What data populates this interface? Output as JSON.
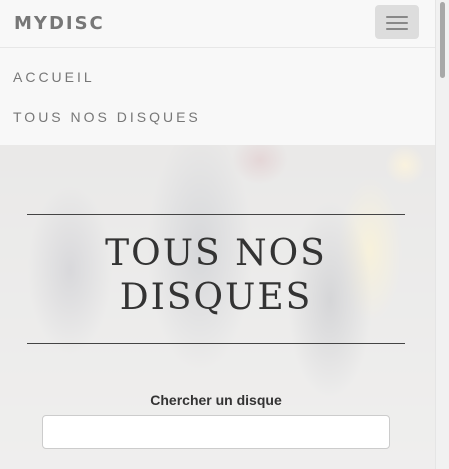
{
  "navbar": {
    "brand": "MYDISC",
    "toggle_icon": "hamburger-icon",
    "menu": [
      {
        "label": "ACCUEIL"
      },
      {
        "label": "TOUS NOS DISQUES"
      }
    ]
  },
  "hero": {
    "title": "TOUS NOS DISQUES"
  },
  "search": {
    "label": "Chercher un disque",
    "value": "",
    "placeholder": ""
  },
  "colors": {
    "navbar_bg": "#f8f8f8",
    "text_muted": "#777777",
    "title": "#333333"
  }
}
